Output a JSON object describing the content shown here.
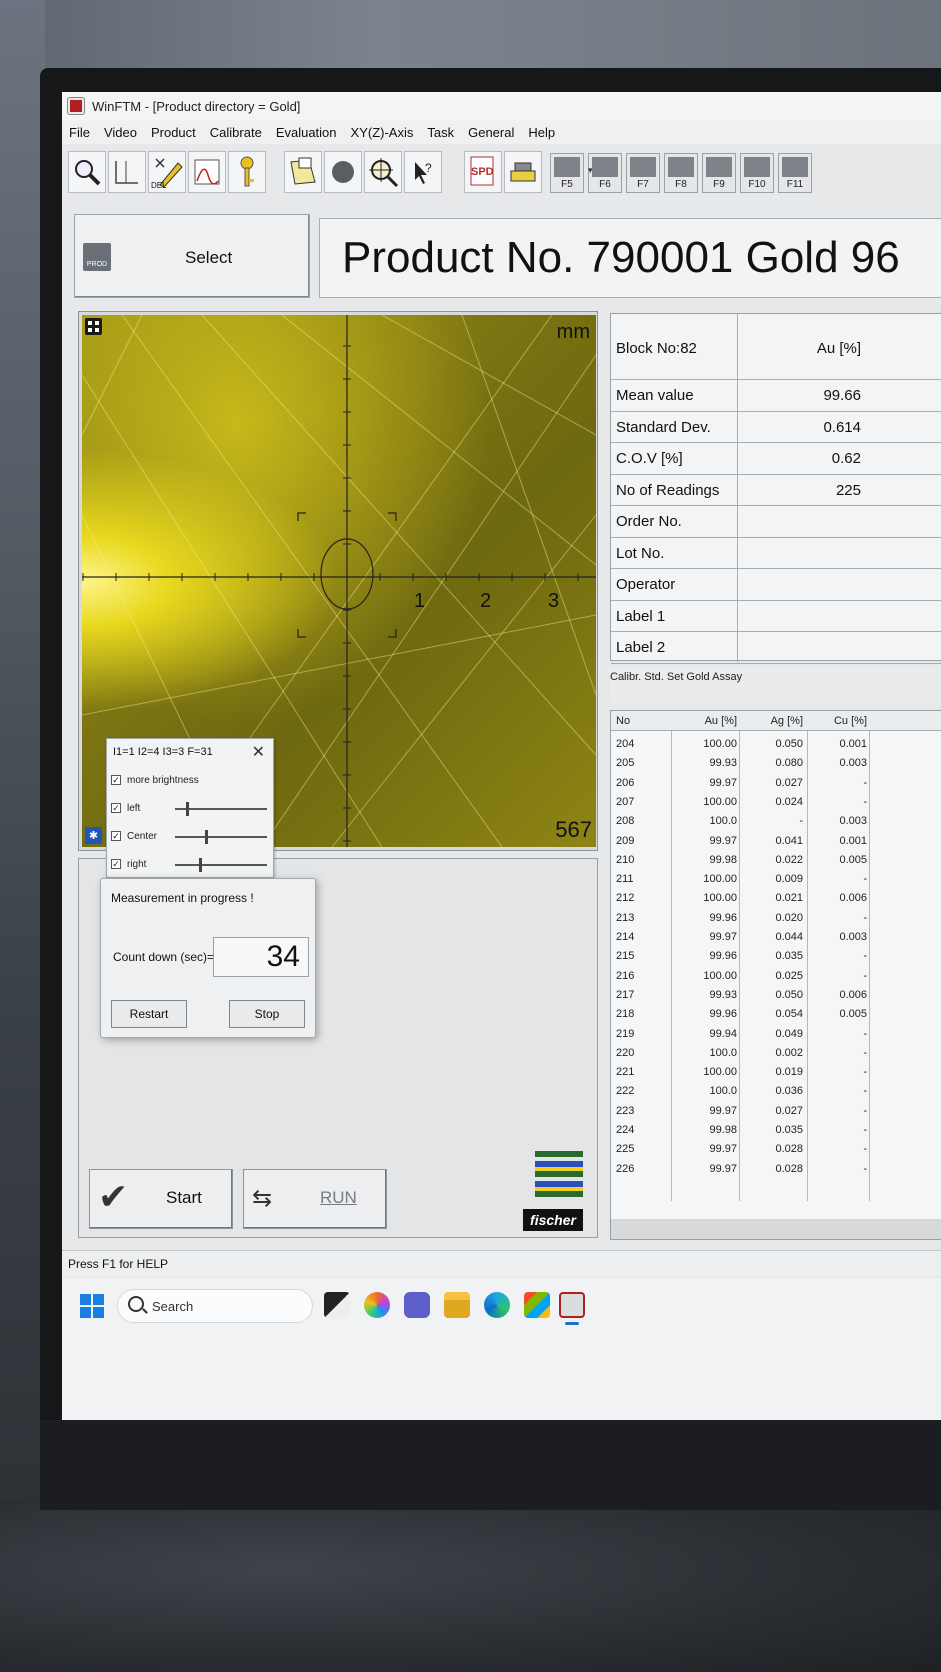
{
  "window": {
    "title": "WinFTM - [Product directory = Gold]"
  },
  "menu": [
    "File",
    "Video",
    "Product",
    "Calibrate",
    "Evaluation",
    "XY(Z)-Axis",
    "Task",
    "General",
    "Help"
  ],
  "toolbar": {
    "icons": [
      "magnify-icon",
      "frame-icon",
      "delete-marker-icon",
      "spectrum-icon",
      "key-icon",
      "document-icon",
      "circle-icon",
      "crosshair-icon",
      "help-cursor-icon",
      "spectrum-report-icon",
      "stage-icon"
    ],
    "delete_label": "DEL",
    "spd_label": "SPD",
    "fkeys": [
      "F5",
      "F6",
      "F7",
      "F8",
      "F9",
      "F10",
      "F11"
    ]
  },
  "select": {
    "icon_label": "PROD",
    "label": "Select"
  },
  "product": {
    "title": "Product No. 790001   Gold 96"
  },
  "video": {
    "unit": "mm",
    "ticks": [
      "1",
      "2",
      "3"
    ],
    "frame_number": "567"
  },
  "brightness": {
    "title": "I1=1 I2=4 I3=3 F=31",
    "more_brightness": "more brightness",
    "rows": [
      {
        "label": "left",
        "value": 0.12
      },
      {
        "label": "Center",
        "value": 0.33
      },
      {
        "label": "right",
        "value": 0.26
      }
    ]
  },
  "measurement": {
    "title": "Measurement in progress !",
    "countdown_label": "Count down (sec)=",
    "countdown_value": "34",
    "restart_label": "Restart",
    "stop_label": "Stop"
  },
  "actions": {
    "start_label": "Start",
    "run_label": "RUN"
  },
  "logo_text": "fischer",
  "stats": {
    "header_key": "Block No:82",
    "header_value": "Au [%]",
    "rows": [
      {
        "k": "Mean value",
        "v": "99.66"
      },
      {
        "k": "Standard Dev.",
        "v": "0.614"
      },
      {
        "k": "C.O.V [%]",
        "v": "0.62"
      },
      {
        "k": "No of Readings",
        "v": "225"
      },
      {
        "k": "Order No.",
        "v": ""
      },
      {
        "k": "Lot No.",
        "v": ""
      },
      {
        "k": "Operator",
        "v": ""
      },
      {
        "k": "Label 1",
        "v": ""
      },
      {
        "k": "Label 2",
        "v": ""
      }
    ]
  },
  "calibration": {
    "label": "Calibr. Std. Set Gold Assay",
    "headers": [
      "No",
      "Au [%]",
      "Ag [%]",
      "Cu [%]"
    ],
    "rows": [
      [
        "204",
        "100.00",
        "0.050",
        "0.001"
      ],
      [
        "205",
        "99.93",
        "0.080",
        "0.003"
      ],
      [
        "206",
        "99.97",
        "0.027",
        "-"
      ],
      [
        "207",
        "100.00",
        "0.024",
        "-"
      ],
      [
        "208",
        "100.0",
        "-",
        "0.003"
      ],
      [
        "209",
        "99.97",
        "0.041",
        "0.001"
      ],
      [
        "210",
        "99.98",
        "0.022",
        "0.005"
      ],
      [
        "211",
        "100.00",
        "0.009",
        "-"
      ],
      [
        "212",
        "100.00",
        "0.021",
        "0.006"
      ],
      [
        "213",
        "99.96",
        "0.020",
        "-"
      ],
      [
        "214",
        "99.97",
        "0.044",
        "0.003"
      ],
      [
        "215",
        "99.96",
        "0.035",
        "-"
      ],
      [
        "216",
        "100.00",
        "0.025",
        "-"
      ],
      [
        "217",
        "99.93",
        "0.050",
        "0.006"
      ],
      [
        "218",
        "99.96",
        "0.054",
        "0.005"
      ],
      [
        "219",
        "99.94",
        "0.049",
        "-"
      ],
      [
        "220",
        "100.0",
        "0.002",
        "-"
      ],
      [
        "221",
        "100.00",
        "0.019",
        "-"
      ],
      [
        "222",
        "100.0",
        "0.036",
        "-"
      ],
      [
        "223",
        "99.97",
        "0.027",
        "-"
      ],
      [
        "224",
        "99.98",
        "0.035",
        "-"
      ],
      [
        "225",
        "99.97",
        "0.028",
        "-"
      ],
      [
        "226",
        "99.97",
        "0.028",
        "-"
      ]
    ]
  },
  "status": {
    "text": "Press F1 for HELP"
  },
  "taskbar": {
    "search_placeholder": "Search",
    "apps": [
      "task-view-icon",
      "copilot-icon",
      "teams-icon",
      "file-explorer-icon",
      "edge-icon",
      "store-icon",
      "winftm-icon"
    ]
  }
}
